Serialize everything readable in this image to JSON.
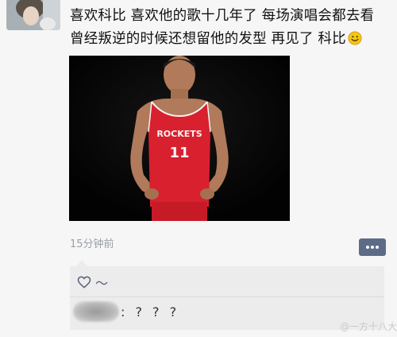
{
  "post": {
    "line1": "喜欢科比 喜欢他的歌十几年了 每场演唱会都去看",
    "line2": "曾经叛逆的时候还想留他的发型 再见了 科比",
    "emoji": "smile-emoji",
    "photo": {
      "jersey_text": "ROCKETS",
      "jersey_number": "11"
    },
    "timestamp": "15分钟前"
  },
  "interactions": {
    "like_icon": "heart-outline-icon",
    "likes_text": "～",
    "comment_icon": "comment-dots-icon",
    "reply_text": ": ? ? ?"
  },
  "watermark": "@一方十八大",
  "colors": {
    "background": "#f6f6f6",
    "link_blue": "#555f78",
    "comment_button": "#5d6b87",
    "jersey_red": "#d8202e"
  }
}
